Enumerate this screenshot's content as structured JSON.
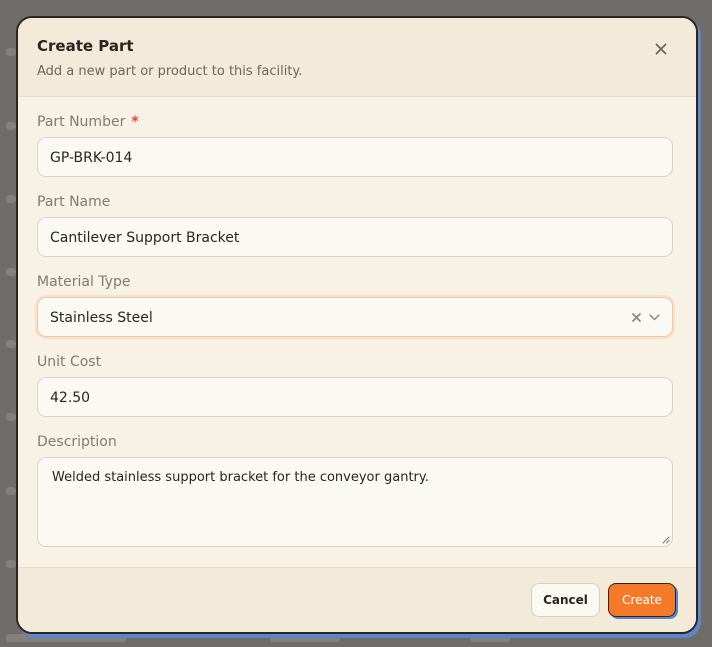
{
  "dialog": {
    "title": "Create Part",
    "subtitle": "Add a new part or product to this facility.",
    "close_icon": "close-icon"
  },
  "fields": {
    "part_number": {
      "label": "Part Number",
      "required_mark": "*",
      "value": "GP-BRK-014"
    },
    "part_name": {
      "label": "Part Name",
      "value": "Cantilever Support Bracket"
    },
    "material_type": {
      "label": "Material Type",
      "value": "Stainless Steel",
      "clear_icon": "clear-icon",
      "chevron_icon": "chevron-down-icon"
    },
    "unit_cost": {
      "label": "Unit Cost",
      "value": "42.50"
    },
    "description": {
      "label": "Description",
      "value": "Welded stainless support bracket for the conveyor gantry."
    }
  },
  "footer": {
    "cancel_label": "Cancel",
    "create_label": "Create"
  },
  "colors": {
    "accent": "#f47a2a",
    "required": "#e5452d",
    "dialog_bg": "#f7f1e6",
    "shadow_blue": "#5d86c8"
  }
}
